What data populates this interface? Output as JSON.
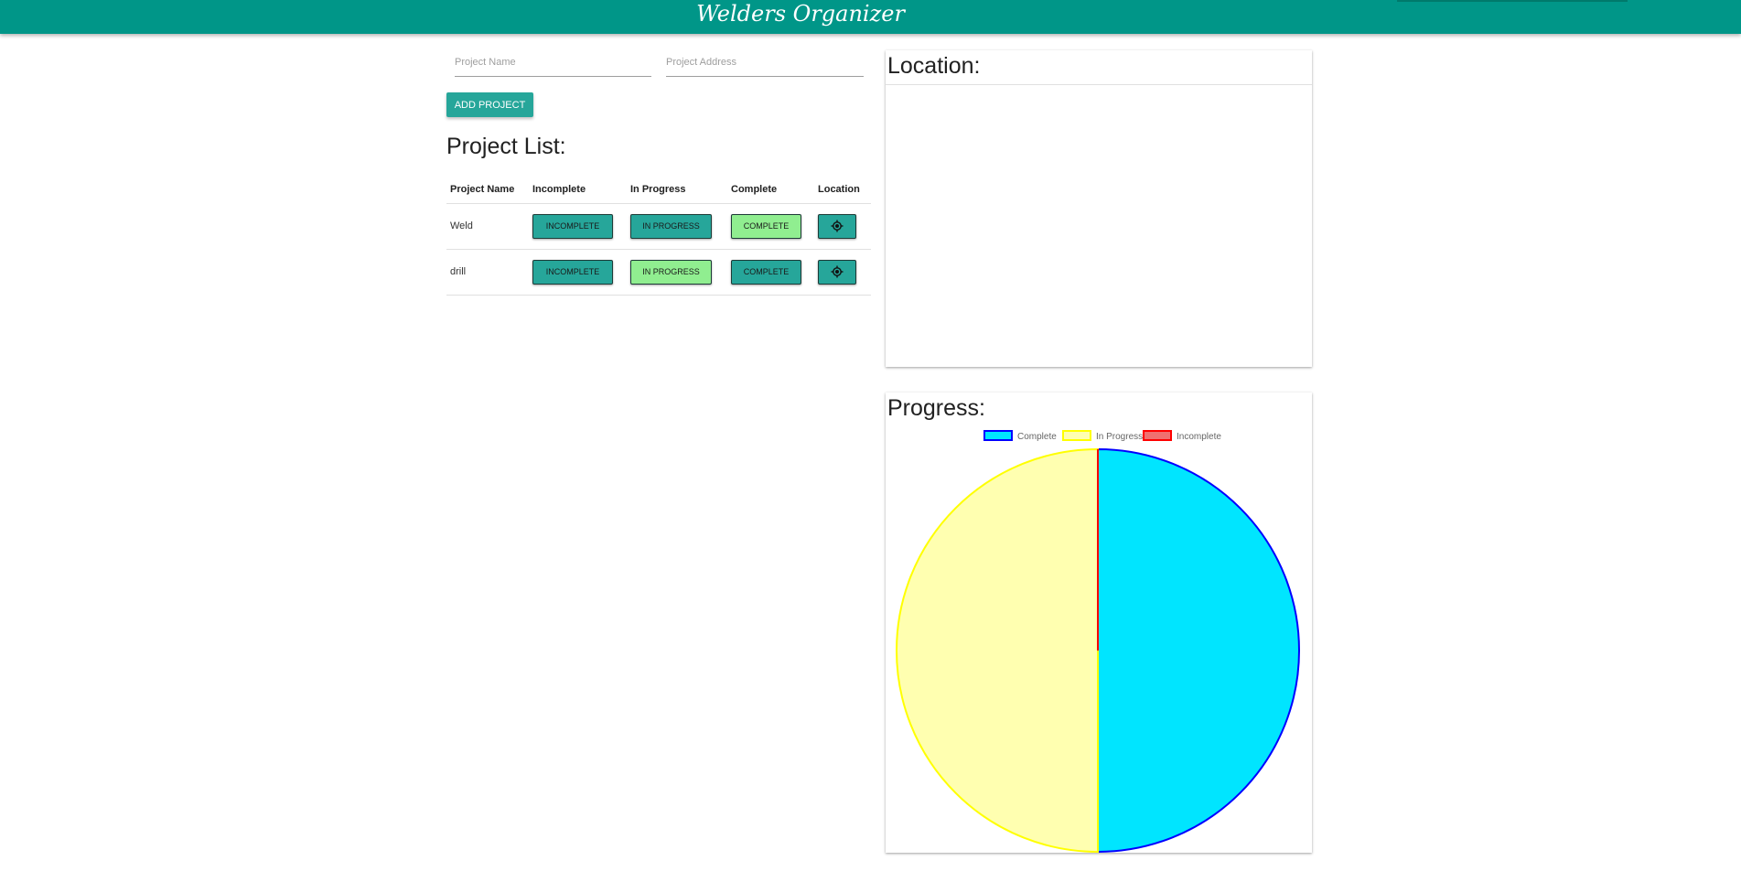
{
  "header": {
    "title": "Welders Organizer"
  },
  "form": {
    "name_placeholder": "Project Name",
    "address_placeholder": "Project Address",
    "add_button": "ADD PROJECT"
  },
  "list": {
    "title": "Project List:",
    "columns": [
      "Project Name",
      "Incomplete",
      "In Progress",
      "Complete",
      "Location"
    ],
    "button_labels": {
      "incomplete": "INCOMPLETE",
      "in_progress": "IN PROGRESS",
      "complete": "COMPLETE"
    },
    "rows": [
      {
        "name": "Weld",
        "status": "complete"
      },
      {
        "name": "drill",
        "status": "in_progress"
      }
    ]
  },
  "location": {
    "title": "Location:"
  },
  "progress": {
    "title": "Progress:"
  },
  "colors": {
    "header": "#009688",
    "button": "#26a69a",
    "active_status": "#90ee90"
  },
  "chart_data": {
    "type": "pie",
    "title": "",
    "legend_position": "top",
    "categories": [
      "Complete",
      "In Progress",
      "Incomplete"
    ],
    "values": [
      1,
      1,
      0
    ],
    "fill_colors": [
      "#00e5ff",
      "#ffffb0",
      "#f07070"
    ],
    "border_colors": [
      "#0000ff",
      "#ffff00",
      "#ff0000"
    ]
  }
}
